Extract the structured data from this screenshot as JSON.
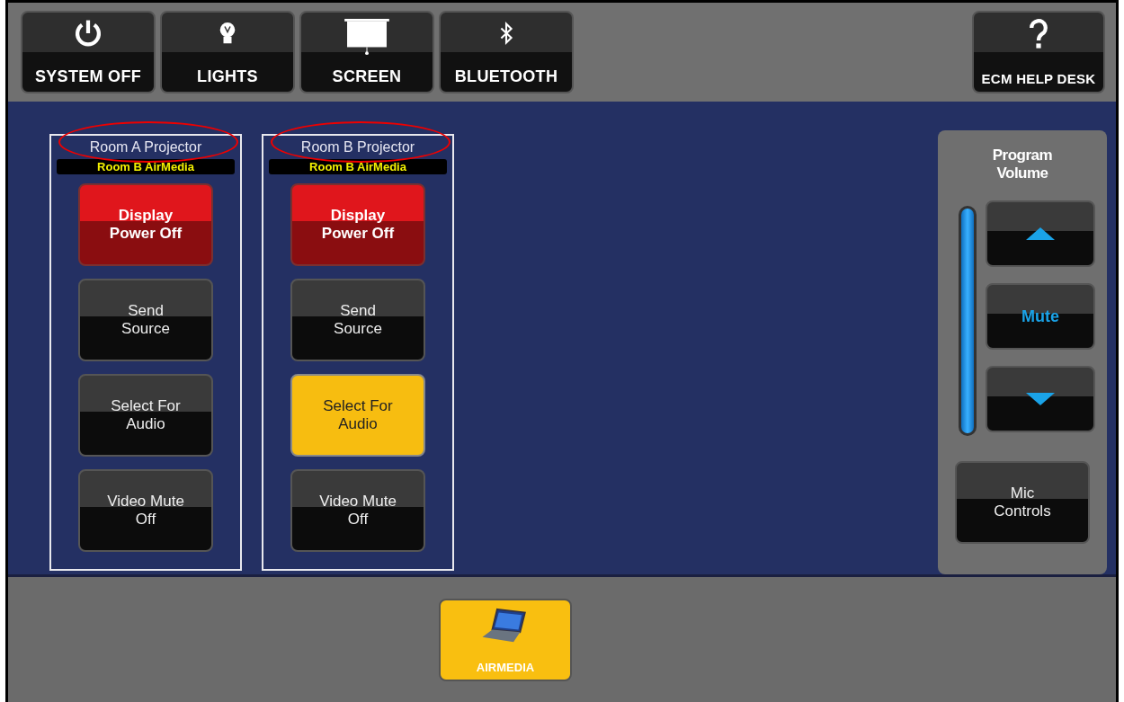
{
  "top_bar": {
    "buttons": [
      {
        "label": "SYSTEM OFF",
        "kind": "power"
      },
      {
        "label": "LIGHTS",
        "kind": "lights"
      },
      {
        "label": "SCREEN",
        "kind": "screen"
      },
      {
        "label": "BLUETOOTH",
        "kind": "bluetooth"
      }
    ],
    "help": {
      "label": "ECM HELP DESK"
    }
  },
  "rooms": [
    {
      "title": "Room A Projector",
      "source": "Room B AirMedia",
      "buttons": [
        {
          "label": "Display Power Off",
          "kind": "power",
          "selected": false
        },
        {
          "label": "Send Source",
          "kind": "action",
          "selected": false
        },
        {
          "label": "Select For Audio",
          "kind": "action",
          "selected": false
        },
        {
          "label": "Video Mute Off",
          "kind": "action",
          "selected": false
        }
      ]
    },
    {
      "title": "Room B Projector",
      "source": "Room B AirMedia",
      "buttons": [
        {
          "label": "Display Power Off",
          "kind": "power",
          "selected": false
        },
        {
          "label": "Send Source",
          "kind": "action",
          "selected": false
        },
        {
          "label": "Select For Audio",
          "kind": "action",
          "selected": true
        },
        {
          "label": "Video Mute Off",
          "kind": "action",
          "selected": false
        }
      ]
    }
  ],
  "volume": {
    "title": "Program Volume",
    "level": 1,
    "mute_label": "Mute",
    "mic_label": "Mic Controls"
  },
  "bottom_bar": {
    "buttons": [
      {
        "label": "AIRMEDIA",
        "selected": true
      }
    ]
  }
}
